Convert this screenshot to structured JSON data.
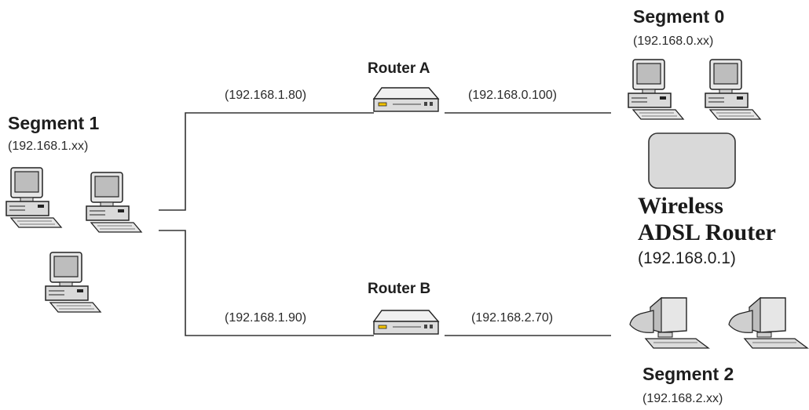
{
  "segment1": {
    "title": "Segment 1",
    "subnet": "(192.168.1.xx)"
  },
  "segment0": {
    "title": "Segment 0",
    "subnet": "(192.168.0.xx)"
  },
  "segment2": {
    "title": "Segment 2",
    "subnet": "(192.168.2.xx)"
  },
  "router_a": {
    "title": "Router A",
    "lan_ip": "(192.168.1.80)",
    "wan_ip": "(192.168.0.100)"
  },
  "router_b": {
    "title": "Router B",
    "lan_ip": "(192.168.1.90)",
    "wan_ip": "(192.168.2.70)"
  },
  "wireless_router": {
    "line1": "Wireless",
    "line2": "ADSL Router",
    "ip": "(192.168.0.1)"
  },
  "colors": {
    "line": "#333333",
    "device_fill": "#d9d9d9",
    "screen": "#bdbdbd",
    "router_led": "#f2c200"
  }
}
